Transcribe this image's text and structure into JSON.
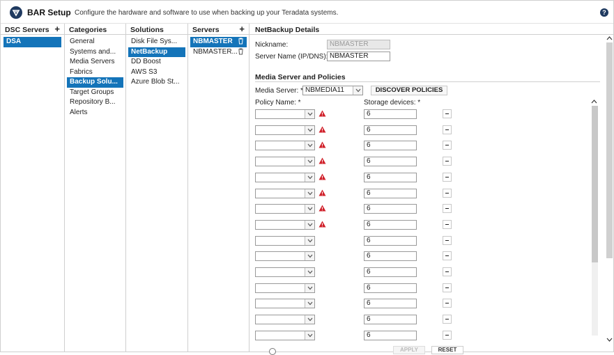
{
  "header": {
    "title": "BAR Setup",
    "subtitle": "Configure the hardware and software to use when backing up your Teradata systems.",
    "help_label": "?"
  },
  "dsc_servers": {
    "title": "DSC Servers",
    "add": "+",
    "items": [
      {
        "label": "DSA",
        "selected": true
      }
    ]
  },
  "categories": {
    "title": "Categories",
    "items": [
      {
        "label": "General"
      },
      {
        "label": "Systems and..."
      },
      {
        "label": "Media Servers"
      },
      {
        "label": "Fabrics"
      },
      {
        "label": "Backup Solu...",
        "selected": true
      },
      {
        "label": "Target Groups"
      },
      {
        "label": "Repository B..."
      },
      {
        "label": "Alerts"
      }
    ]
  },
  "solutions": {
    "title": "Solutions",
    "items": [
      {
        "label": "Disk File Sys..."
      },
      {
        "label": "NetBackup",
        "selected": true
      },
      {
        "label": "DD Boost"
      },
      {
        "label": "AWS S3"
      },
      {
        "label": "Azure Blob St..."
      }
    ]
  },
  "servers": {
    "title": "Servers",
    "add": "+",
    "items": [
      {
        "label": "NBMASTER",
        "selected": true
      },
      {
        "label": "NBMASTER..."
      }
    ]
  },
  "details": {
    "title": "NetBackup Details",
    "nickname_label": "Nickname:",
    "nickname_value": "NBMASTER",
    "server_name_label": "Server Name (IP/DNS): *",
    "server_name_value": "NBMASTER",
    "section_title": "Media Server and Policies",
    "media_server_label": "Media Server: *",
    "media_server_value": "NBMEDIA11",
    "discover_button": "DISCOVER POLICIES",
    "policy_col": "Policy Name: *",
    "storage_col": "Storage devices: *",
    "policies": [
      {
        "storage": "6",
        "warning": true
      },
      {
        "storage": "6",
        "warning": true
      },
      {
        "storage": "6",
        "warning": true
      },
      {
        "storage": "6",
        "warning": true
      },
      {
        "storage": "6",
        "warning": true
      },
      {
        "storage": "6",
        "warning": true
      },
      {
        "storage": "6",
        "warning": true
      },
      {
        "storage": "6",
        "warning": true
      },
      {
        "storage": "6",
        "warning": false
      },
      {
        "storage": "6",
        "warning": false
      },
      {
        "storage": "6",
        "warning": false
      },
      {
        "storage": "6",
        "warning": false
      },
      {
        "storage": "6",
        "warning": false
      },
      {
        "storage": "6",
        "warning": false
      },
      {
        "storage": "6",
        "warning": false
      }
    ],
    "apply_button": "APPLY",
    "reset_button": "RESET"
  },
  "colors": {
    "selection": "#1474b9",
    "warning": "#d0202a",
    "brand": "#1f3a60"
  }
}
